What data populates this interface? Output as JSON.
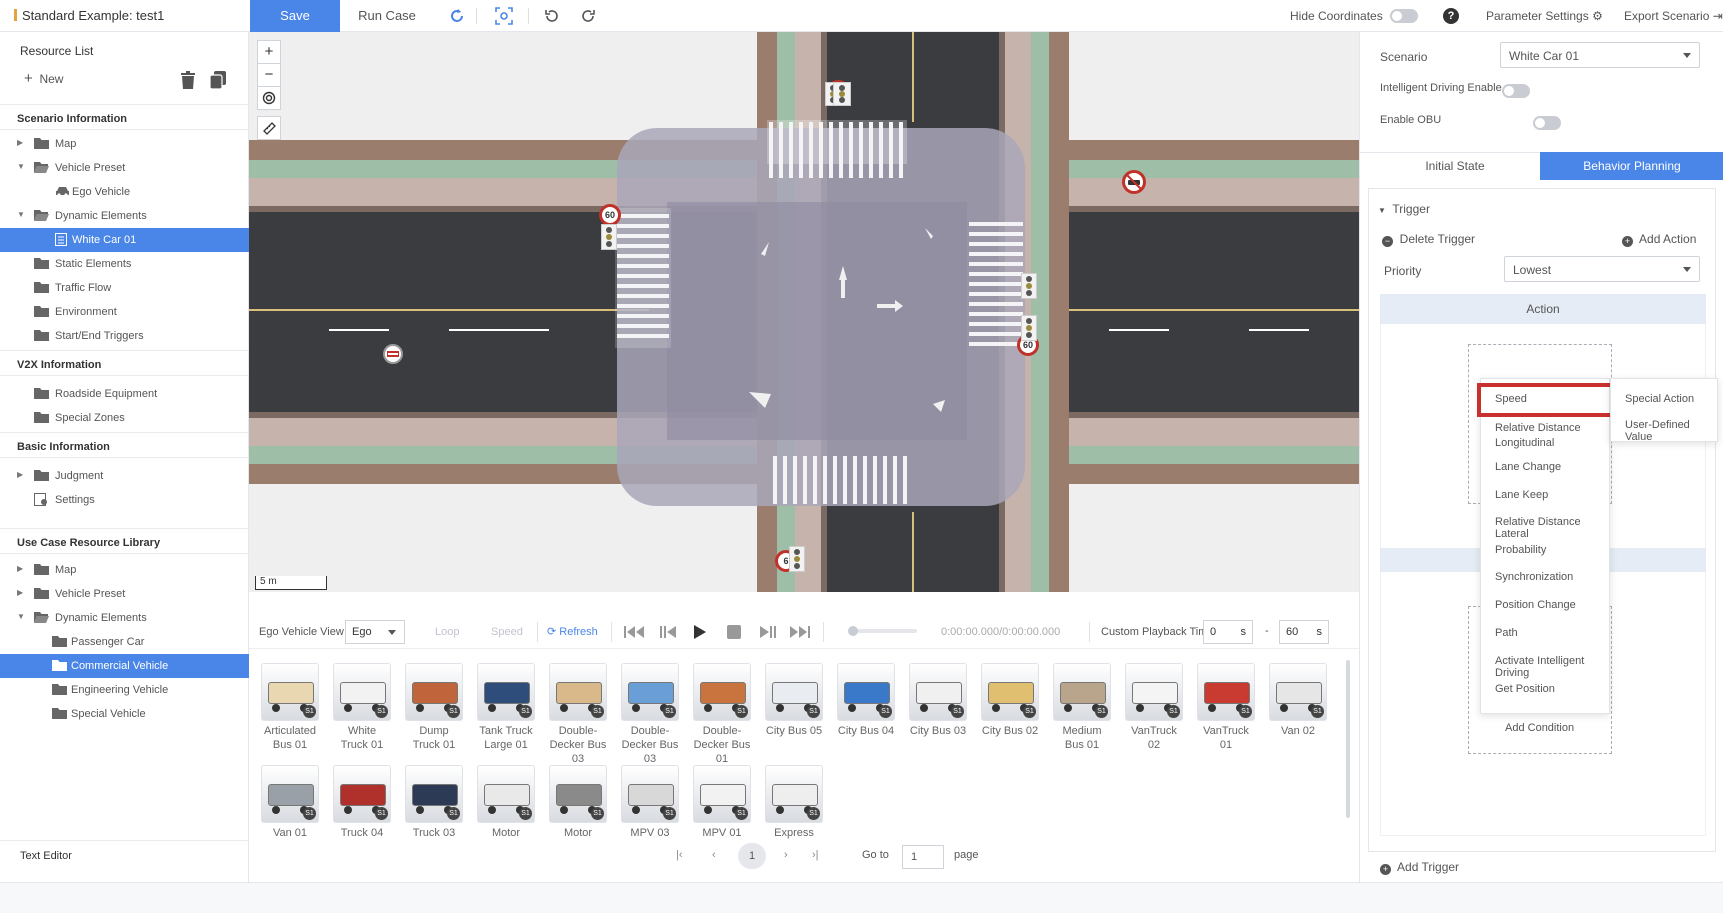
{
  "topbar": {
    "title": "Standard Example: test1",
    "save": "Save",
    "run_case": "Run Case",
    "hide_coordinates": "Hide Coordinates",
    "help": "?",
    "parameter_settings": "Parameter Settings",
    "export_scenario": "Export Scenario"
  },
  "left": {
    "resource_list": "Resource List",
    "new": "New",
    "scenario_info": "Scenario Information",
    "scenario_items": [
      "Map",
      "Vehicle Preset",
      "Ego Vehicle",
      "Dynamic Elements",
      "White Car 01",
      "Static Elements",
      "Traffic Flow",
      "Environment",
      "Start/End Triggers"
    ],
    "v2x_info": "V2X Information",
    "v2x_items": [
      "Roadside Equipment",
      "Special Zones"
    ],
    "basic_info": "Basic Information",
    "basic_items": [
      "Judgment",
      "Settings"
    ],
    "use_case_lib": "Use Case Resource Library",
    "lib_items": [
      "Map",
      "Vehicle Preset",
      "Dynamic Elements",
      "Passenger Car",
      "Commercial Vehicle",
      "Engineering Vehicle",
      "Special Vehicle"
    ],
    "text_editor": "Text Editor"
  },
  "map": {
    "zoom_in": "+",
    "zoom_out": "−",
    "scale": "5 m",
    "signs": [
      "60",
      "60",
      "30",
      "6"
    ]
  },
  "playback": {
    "view_label": "Ego Vehicle View",
    "view_value": "Ego",
    "loop": "Loop",
    "speed": "Speed",
    "refresh": "Refresh",
    "time": "0:00:00.000/0:00:00.000",
    "custom_label": "Custom Playback Time",
    "start": "0",
    "end": "60",
    "unit": "s",
    "dash": "-"
  },
  "vehicles": [
    {
      "name": "Articulated Bus 01",
      "color": "#e8d7b0"
    },
    {
      "name": "White Truck 01",
      "color": "#f2f2f2"
    },
    {
      "name": "Dump Truck 01",
      "color": "#c0643c"
    },
    {
      "name": "Tank Truck Large 01",
      "color": "#2e4d7a"
    },
    {
      "name": "Double-Decker Bus 03",
      "color": "#d9b88a"
    },
    {
      "name": "Double-Decker Bus 03",
      "color": "#6a9ed6"
    },
    {
      "name": "Double-Decker Bus 01",
      "color": "#c9743f"
    },
    {
      "name": "City Bus 05",
      "color": "#e9edf2"
    },
    {
      "name": "City Bus 04",
      "color": "#3a78c9"
    },
    {
      "name": "City Bus 03",
      "color": "#f0f0f0"
    },
    {
      "name": "City Bus 02",
      "color": "#e0c070"
    },
    {
      "name": "Medium Bus 01",
      "color": "#b8a58c"
    },
    {
      "name": "VanTruck 02",
      "color": "#f4f4f4"
    },
    {
      "name": "VanTruck 01",
      "color": "#c93a30"
    },
    {
      "name": "Van 02",
      "color": "#e6e6e6"
    },
    {
      "name": "Van 01",
      "color": "#9aa0a8"
    },
    {
      "name": "Truck 04",
      "color": "#b0302c"
    },
    {
      "name": "Truck 03",
      "color": "#2d3a55"
    },
    {
      "name": "Motor",
      "color": "#e9e9e9"
    },
    {
      "name": "Motor",
      "color": "#8a8a8a"
    },
    {
      "name": "MPV 03",
      "color": "#d8d8d8"
    },
    {
      "name": "MPV 01",
      "color": "#f2f2f2"
    },
    {
      "name": "Express",
      "color": "#eeeeee"
    }
  ],
  "badge": "S1",
  "pager": {
    "current": "1",
    "goto": "Go to",
    "page": "page",
    "input": "1"
  },
  "right": {
    "scenario_label": "Scenario",
    "scenario_value": "White Car 01",
    "intelligent_driving": "Intelligent Driving Enable",
    "enable_obu": "Enable OBU",
    "tab_initial": "Initial State",
    "tab_behavior": "Behavior Planning",
    "trigger": "Trigger",
    "delete_trigger": "Delete Trigger",
    "add_action": "Add Action",
    "priority_label": "Priority",
    "priority_value": "Lowest",
    "action_header": "Action",
    "add_condition": "Add Condition",
    "add_trigger": "Add Trigger",
    "menu_items": [
      "Speed",
      "Relative Distance Longitudinal",
      "Lane Change",
      "Lane Keep",
      "Relative Distance Lateral",
      "Probability",
      "Synchronization",
      "Position Change",
      "Path",
      "Activate Intelligent Driving",
      "Get Position"
    ],
    "submenu_items": [
      "Special Action",
      "User-Defined Value"
    ]
  },
  "colors": {
    "accent": "#4a86e8",
    "highlight": "#c8312e"
  }
}
